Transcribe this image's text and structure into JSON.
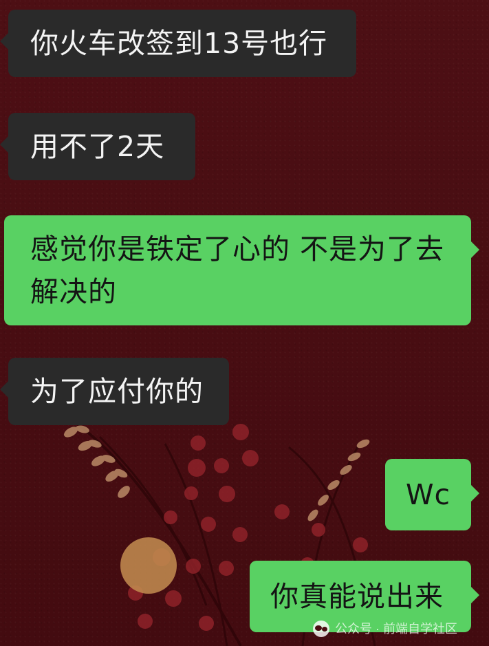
{
  "messages": [
    {
      "id": "m1",
      "side": "incoming",
      "text": "你火车改签到13号也行"
    },
    {
      "id": "m2",
      "side": "incoming",
      "text": "用不了2天"
    },
    {
      "id": "m3",
      "side": "outgoing",
      "text": "感觉你是铁定了心的 不是为了去\n解决的"
    },
    {
      "id": "m4",
      "side": "incoming",
      "text": "为了应付你的"
    },
    {
      "id": "m5",
      "side": "outgoing",
      "text": "Wc"
    },
    {
      "id": "m6",
      "side": "outgoing",
      "text": "你真能说出来"
    }
  ],
  "watermark": {
    "icon": "wechat-official-account-icon",
    "text": "公众号 · 前端自学社区"
  },
  "colors": {
    "background": "#4a0d12",
    "incoming_bubble": "#2a2a2a",
    "outgoing_bubble": "#59d163",
    "incoming_text": "#f4f4f4",
    "outgoing_text": "#141414"
  }
}
